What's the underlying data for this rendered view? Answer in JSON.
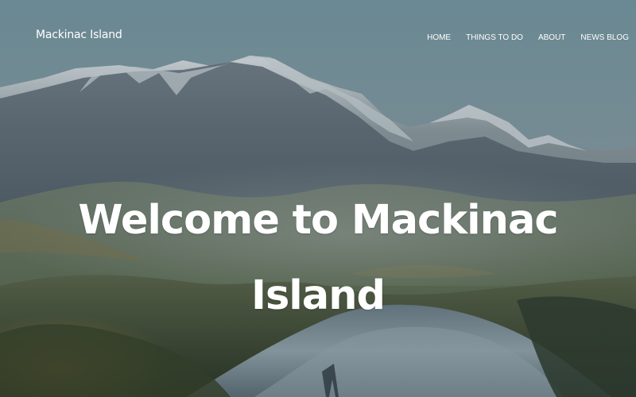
{
  "site": {
    "brand": "Mackinac Island"
  },
  "nav": {
    "items": [
      {
        "label": "HOME"
      },
      {
        "label": "THINGS TO DO"
      },
      {
        "label": "ABOUT"
      },
      {
        "label": "NEWS BLOG"
      }
    ]
  },
  "hero": {
    "title_line1": "Welcome to Mackinac",
    "title_line2": "Island"
  }
}
